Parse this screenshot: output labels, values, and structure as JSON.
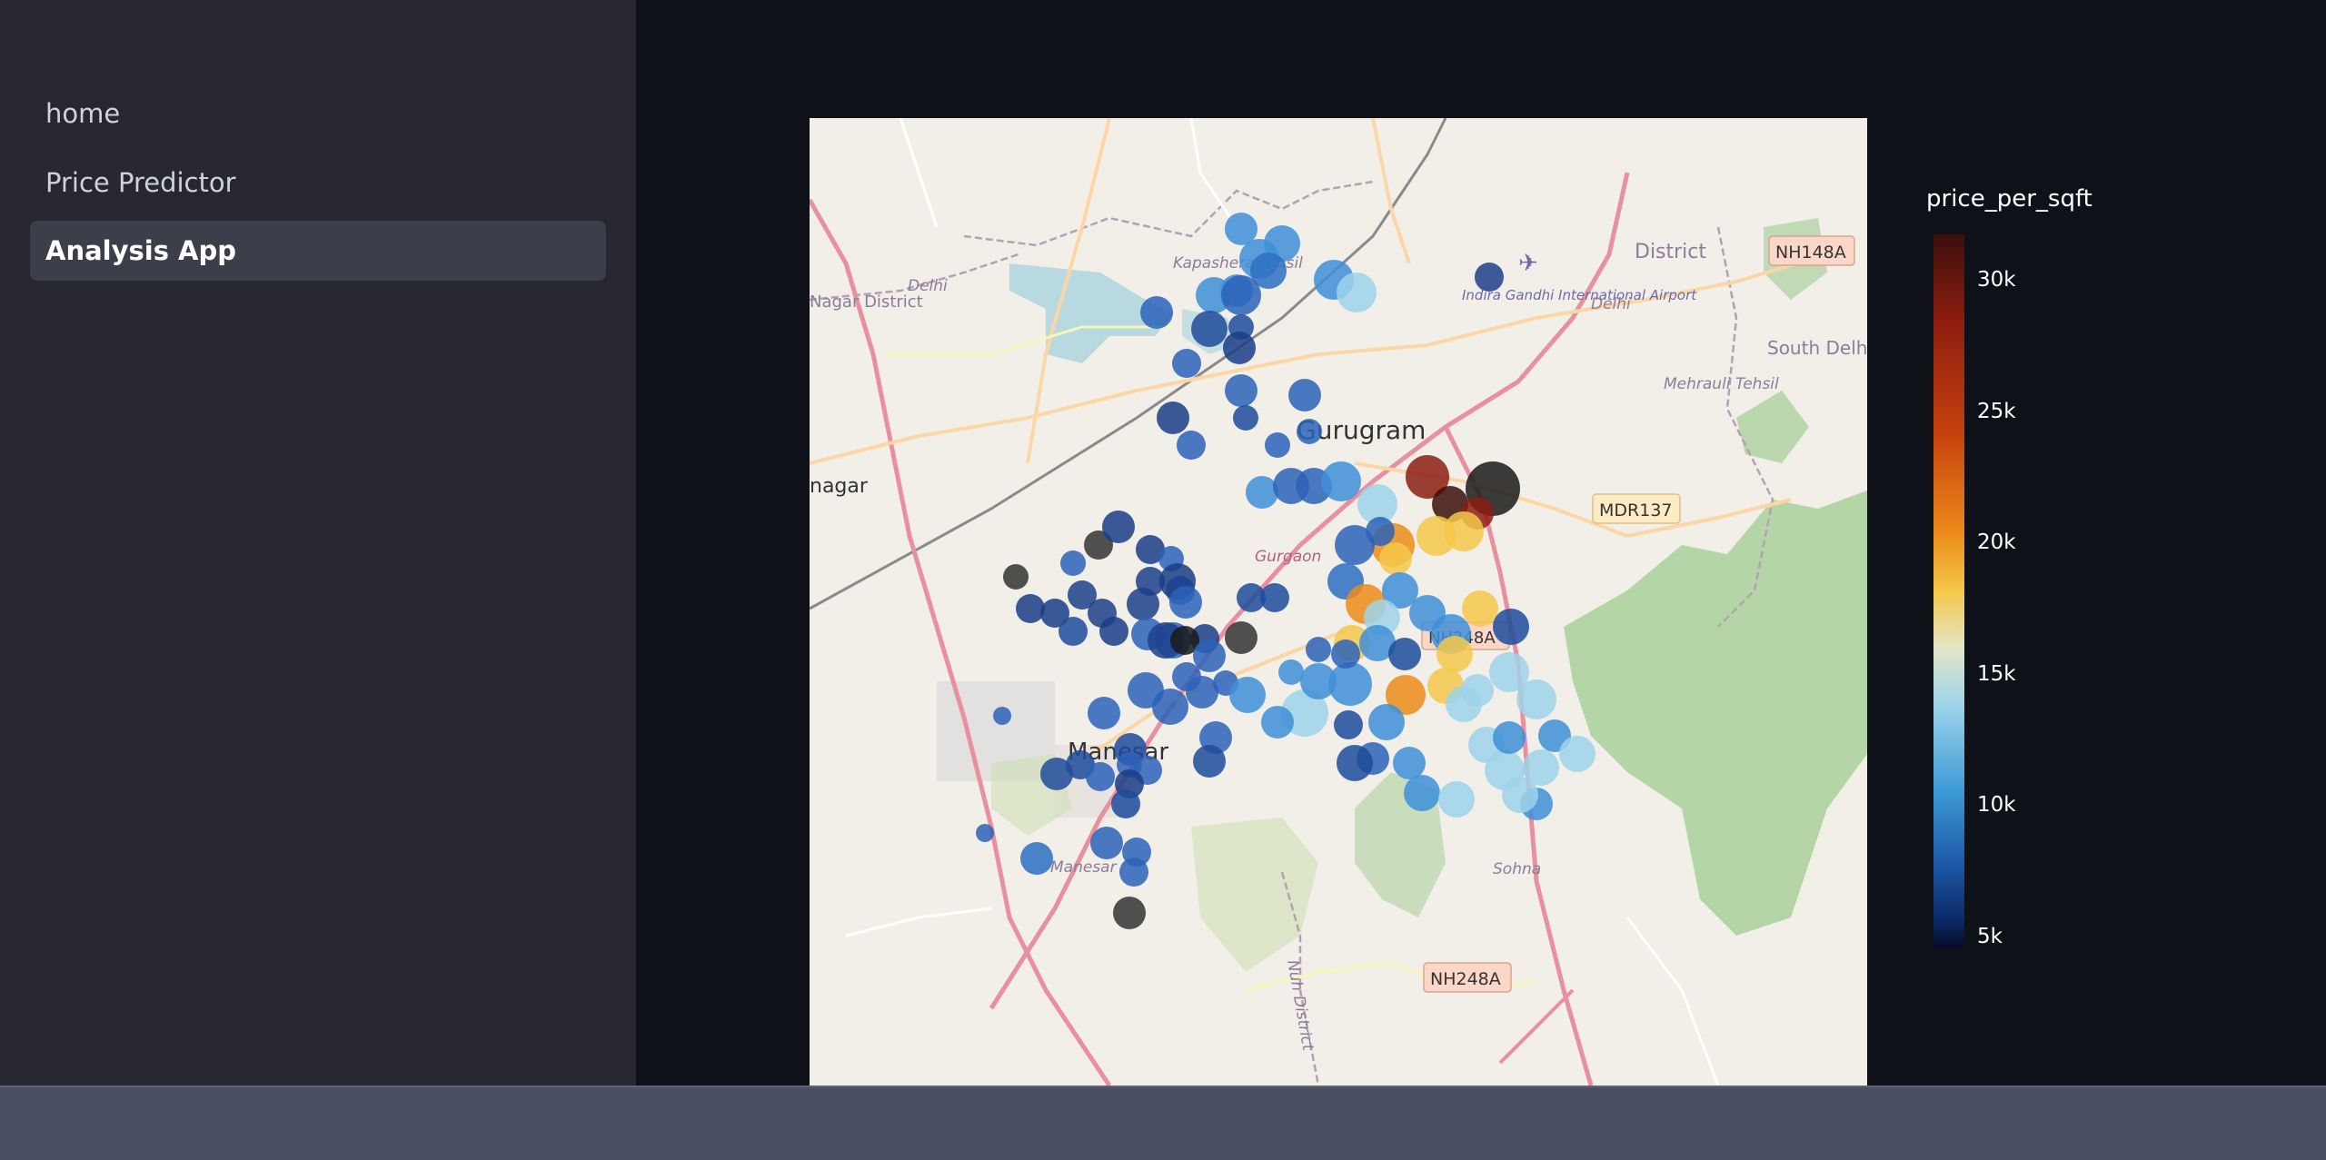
{
  "sidebar": {
    "items": [
      {
        "label": "home",
        "active": false
      },
      {
        "label": "Price Predictor",
        "active": false
      },
      {
        "label": "Analysis App",
        "active": true
      }
    ]
  },
  "map": {
    "labels": {
      "gurugram": "Gurugram",
      "manesar": "Manesar",
      "airport": "Indira Gandhi International Airport",
      "kapashera": "Kapashera Tehsil",
      "delhi1": "Delhi",
      "delhi2": "Delhi",
      "district": "District",
      "south_delhi": "South Delhi District",
      "mehrauli": "Mehrauli Tehsil",
      "nagar": "nagar",
      "nagar_district": "Nagar District",
      "gurgaon": "Gurgaon",
      "manesar_small": "Manesar",
      "sohna": "Sohna",
      "nuh": "Nuh District"
    },
    "road_badges": [
      "NH148A",
      "MDR137",
      "NH248A",
      "NH248A"
    ]
  },
  "chart_data": {
    "type": "scatter",
    "color_variable": "price_per_sqft",
    "colorbar": {
      "title": "price_per_sqft",
      "ticks": [
        "30k",
        "25k",
        "20k",
        "15k",
        "10k",
        "5k"
      ],
      "range": [
        4000,
        32000
      ]
    }
  },
  "colors": {
    "sidebar_bg": "#262730",
    "main_bg": "#0e1117",
    "active_item_bg": "#3c3e4a",
    "map_land": "#f2efe9"
  }
}
